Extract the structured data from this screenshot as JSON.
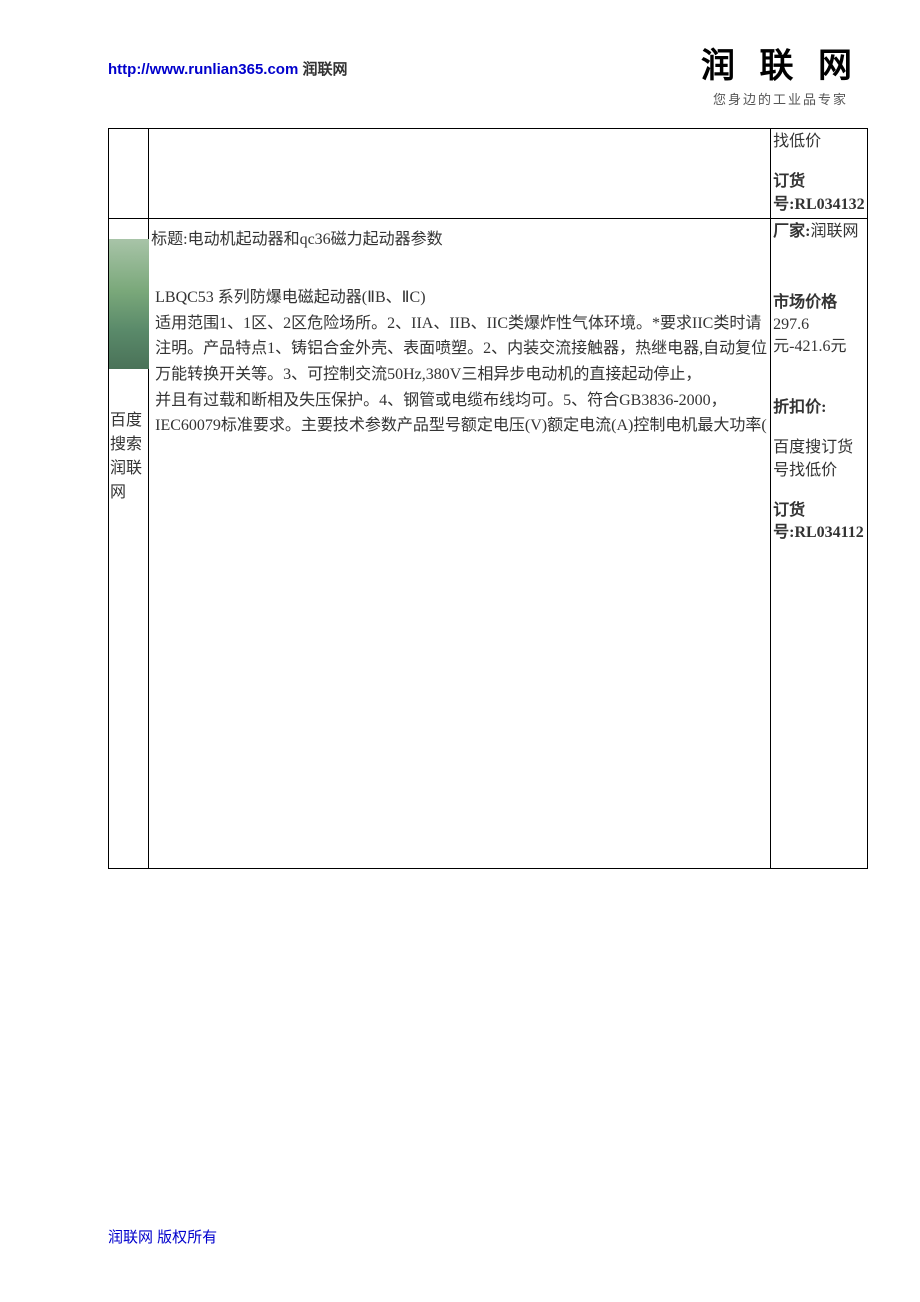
{
  "header": {
    "url": "http://www.runlian365.com",
    "site_name": "润联网",
    "logo_main": "润 联 网",
    "logo_sub": "您身边的工业品专家"
  },
  "row1": {
    "right_line1": "找低价",
    "right_line2_prefix": "订货号:",
    "right_line2_value": "RL034132"
  },
  "row2": {
    "left_text": "百度搜索润联网",
    "title_label": "标题:",
    "title_text": "电动机起动器和qc36磁力起动器参数",
    "body_line1": "LBQC53 系列防爆电磁起动器(ⅡB、ⅡC)",
    "body_line2": "适用范围1、1区、2区危险场所。2、IIA、IIB、IIC类爆炸性气体环境。*要求IIC类时请注明。产品特点1、铸铝合金外壳、表面喷塑。2、内装交流接触器，热继电器,自动复位万能转换开关等。3、可控制交流50Hz,380V三相异步电动机的直接起动停止，",
    "body_line3": "并且有过载和断相及失压保护。4、钢管或电缆布线均可。5、符合GB3836-2000，IEC60079标准要求。主要技术参数产品型号额定电压(V)额定电流(A)控制电机最大功率(",
    "right_block1_label": "厂家:",
    "right_block1_value": "润联网",
    "right_block2_label": "市场价格",
    "right_block2_value": "297.6元-421.6元",
    "right_block3_label": "折扣价:",
    "right_block4": "百度搜订货号找低价",
    "right_block5_label": "订货号:",
    "right_block5_value": "RL034112"
  },
  "footer": {
    "text": "润联网 版权所有"
  }
}
